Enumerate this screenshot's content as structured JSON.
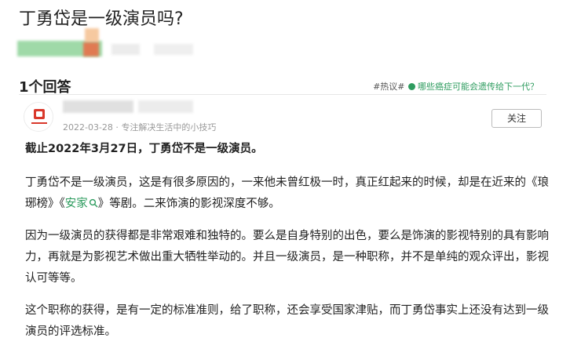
{
  "question": {
    "title": "丁勇岱是一级演员吗?"
  },
  "answers": {
    "count_label": "1个回答"
  },
  "hot": {
    "prefix": "#热议# ",
    "topic": "哪些癌症可能会遗传给下一代？"
  },
  "author": {
    "date": "2022-03-28",
    "separator": " · ",
    "bio": "专注解决生活中的小技巧",
    "follow_label": "关注"
  },
  "content": {
    "lead": "截止2022年3月27日，丁勇岱不是一级演员。",
    "p1_a": "丁勇岱不是一级演员，这是有很多原因的，一来他未曾红极一时，真正红起来的时候，却是在近来的《琅琊榜》《",
    "p1_link": "安家",
    "p1_b": "》等剧。二来饰演的影视深度不够。",
    "p2": "因为一级演员的获得都是非常艰难和独特的。要么是自身特别的出色，要么是饰演的影视特别的具有影响力，再就是为影视艺术做出重大牺牲举动的。并且一级演员，是一种职称，并不是单纯的观众评出，影视认可等等。",
    "p3": "这个职称的获得，是有一定的标准准则，给了职称，还会享受国家津贴，而丁勇岱事实上还没有达到一级演员的评选标准。"
  },
  "colors": {
    "accent_green": "#2e9c5f",
    "meta_gray": "#999999"
  }
}
